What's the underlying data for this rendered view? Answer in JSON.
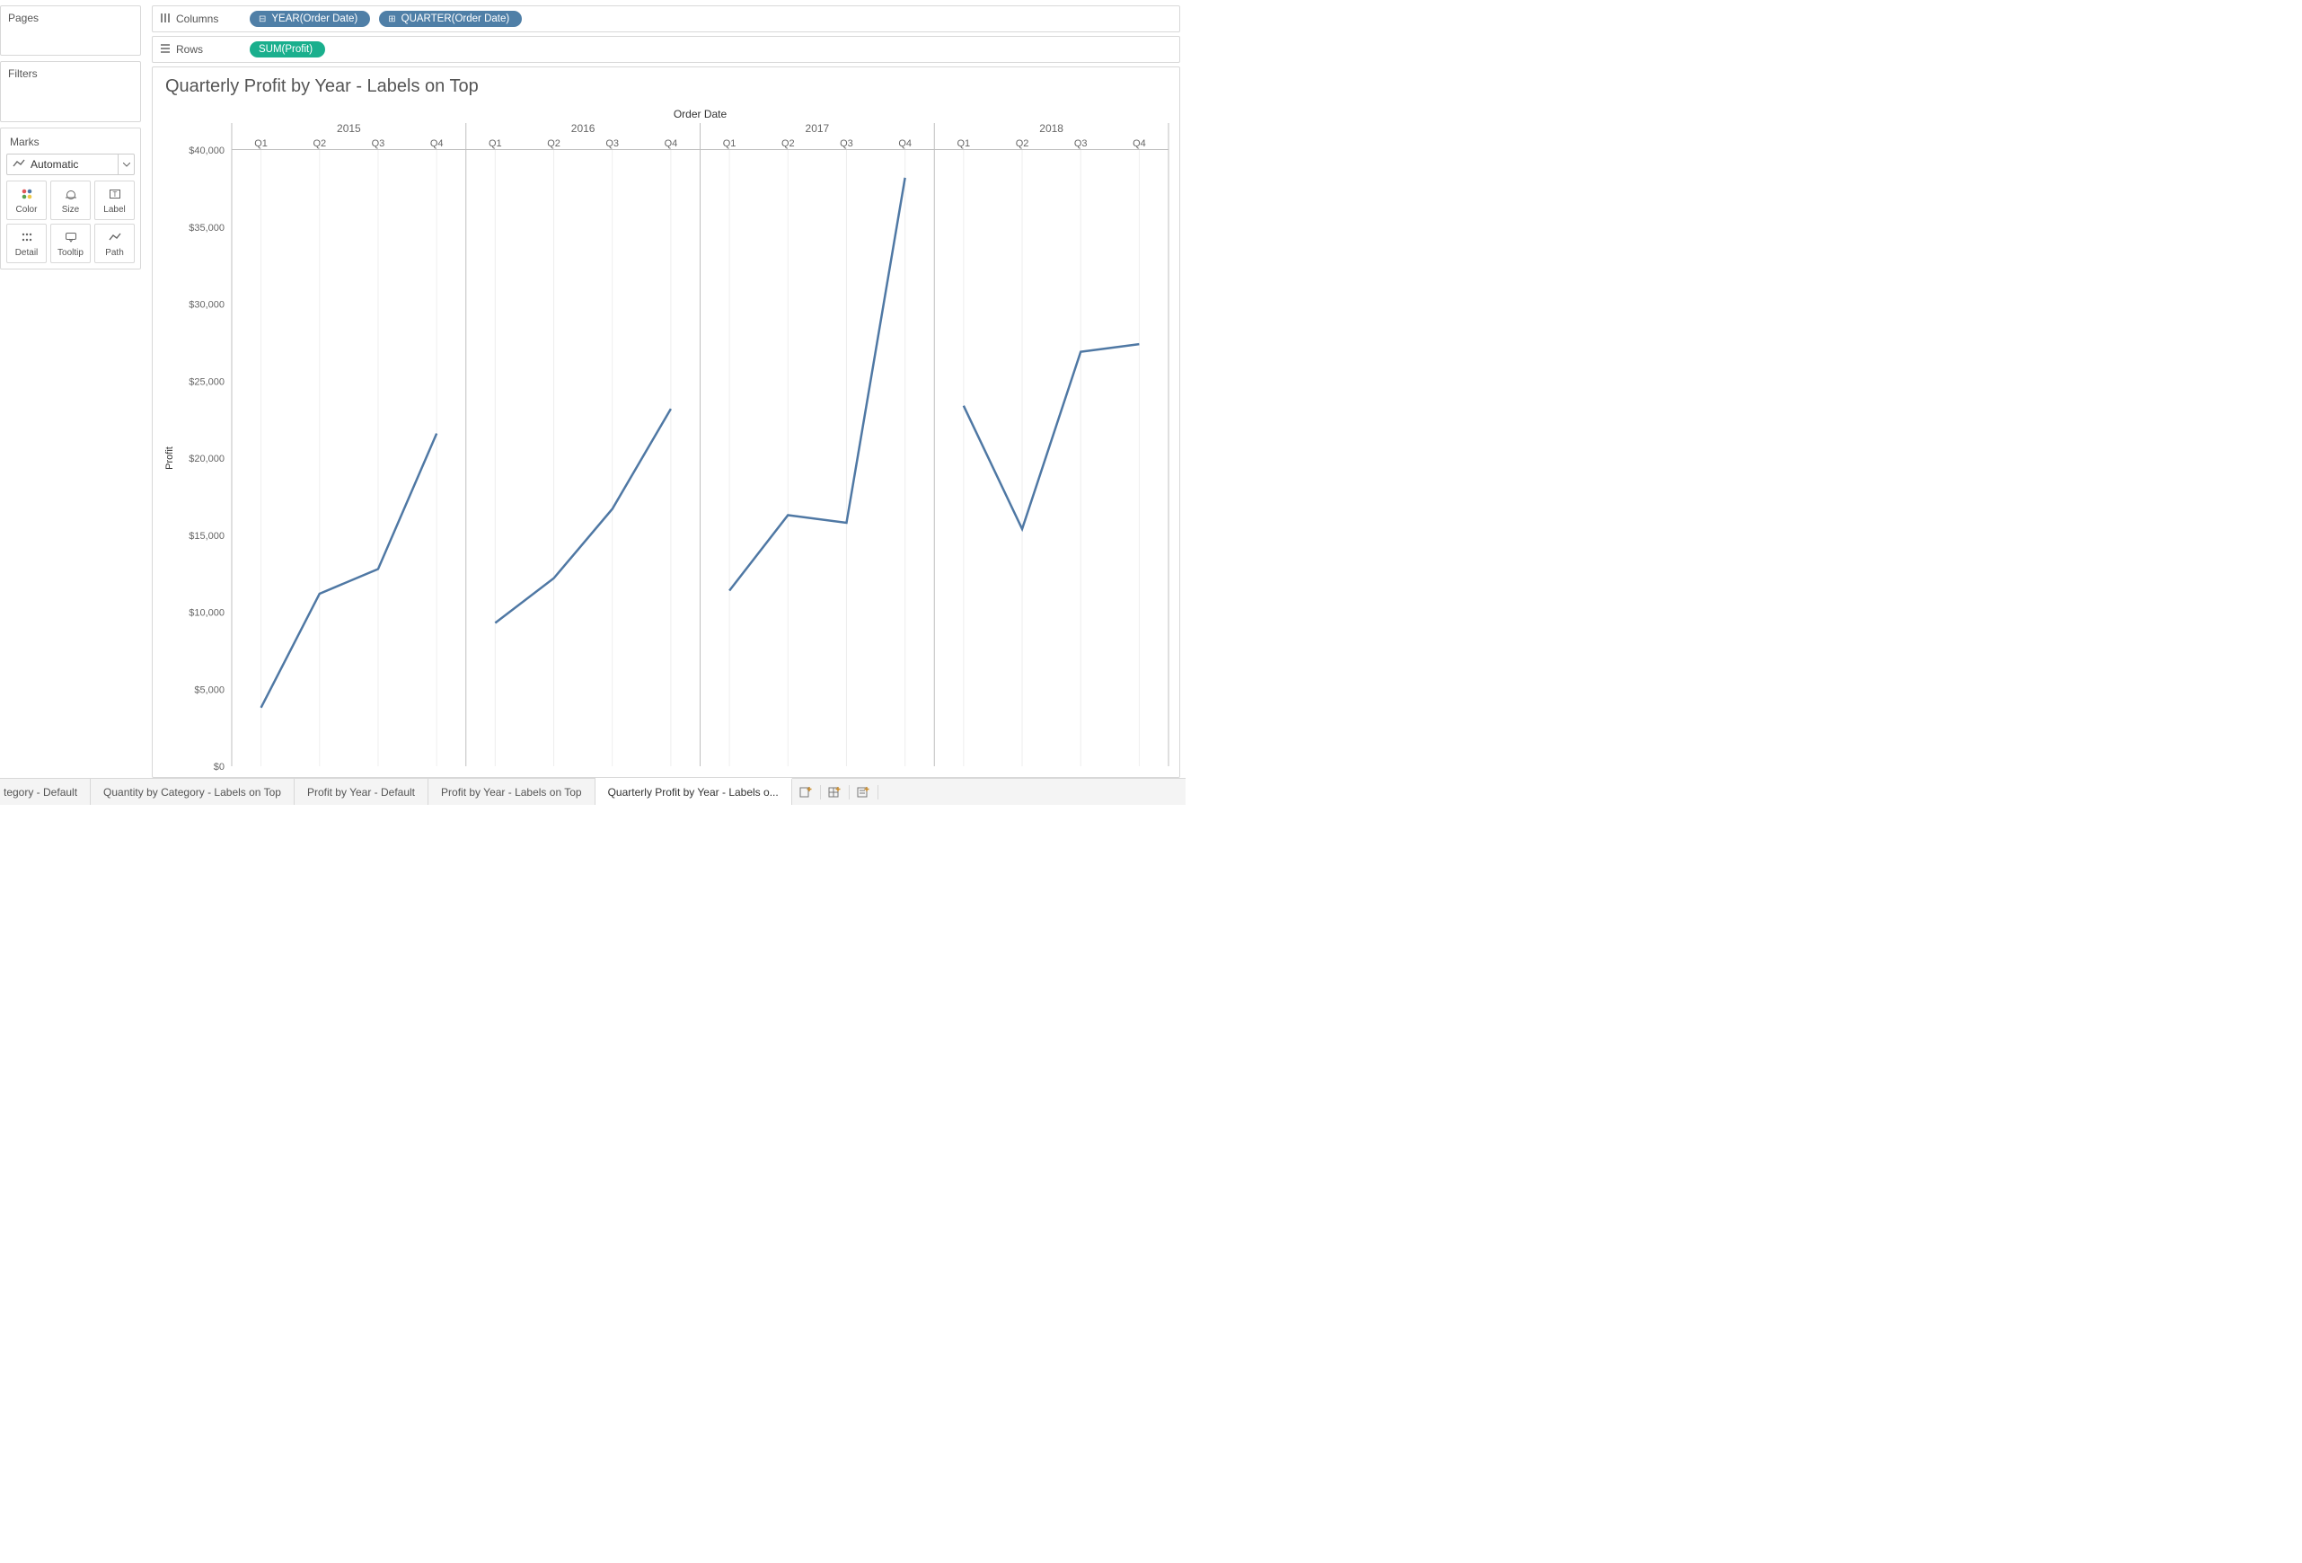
{
  "sidebar": {
    "pages_title": "Pages",
    "filters_title": "Filters",
    "marks_title": "Marks",
    "mark_type": "Automatic",
    "cells": {
      "color": "Color",
      "size": "Size",
      "label": "Label",
      "detail": "Detail",
      "tooltip": "Tooltip",
      "path": "Path"
    }
  },
  "shelves": {
    "columns_label": "Columns",
    "rows_label": "Rows",
    "year_pill": "YEAR(Order Date)",
    "quarter_pill": "QUARTER(Order Date)",
    "sum_pill": "SUM(Profit)"
  },
  "chart": {
    "title": "Quarterly Profit by Year - Labels on Top",
    "col_axis_title": "Order Date",
    "y_axis_title": "Profit"
  },
  "tabs": {
    "partial_left": "tegory - Default",
    "t1": "Quantity by Category - Labels on Top",
    "t2": "Profit by Year - Default",
    "t3": "Profit by Year - Labels on Top",
    "t4": "Quarterly Profit by Year - Labels o..."
  },
  "chart_data": {
    "type": "line",
    "title": "Quarterly Profit by Year - Labels on Top",
    "col_axis_title": "Order Date",
    "ylabel": "Profit",
    "ylim": [
      0,
      40000
    ],
    "y_ticks": [
      0,
      5000,
      10000,
      15000,
      20000,
      25000,
      30000,
      35000,
      40000
    ],
    "y_tick_labels": [
      "$0",
      "$5,000",
      "$10,000",
      "$15,000",
      "$20,000",
      "$25,000",
      "$30,000",
      "$35,000",
      "$40,000"
    ],
    "quarters": [
      "Q1",
      "Q2",
      "Q3",
      "Q4"
    ],
    "years": [
      "2015",
      "2016",
      "2017",
      "2018"
    ],
    "series": [
      {
        "name": "2015",
        "values": [
          3800,
          11200,
          12800,
          21600
        ]
      },
      {
        "name": "2016",
        "values": [
          9300,
          12200,
          16700,
          23200
        ]
      },
      {
        "name": "2017",
        "values": [
          11400,
          16300,
          15800,
          38200
        ]
      },
      {
        "name": "2018",
        "values": [
          23400,
          15400,
          26900,
          27400
        ]
      }
    ]
  }
}
